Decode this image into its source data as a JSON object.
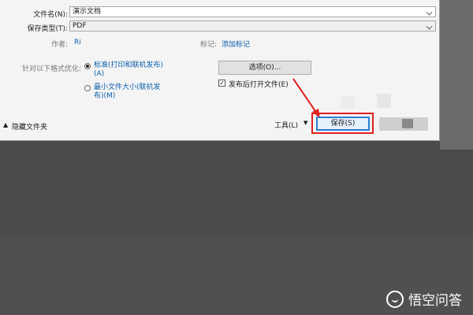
{
  "dialog": {
    "filename_label": "文件名(N):",
    "filename_value": "演示文档",
    "filetype_label": "保存类型(T):",
    "filetype_value": "PDF",
    "author_label": "作者:",
    "author_value": "Ri",
    "tags_label": "标记:",
    "tags_link": "添加标记",
    "optimize_label": "针对以下格式优化:",
    "option_standard_line1": "标准(打印和联机发布)",
    "option_standard_line2": "(A)",
    "option_min_line1": "最小文件大小(联机发",
    "option_min_line2": "布)(M)",
    "options_button": "选项(O)...",
    "open_after_publish": "发布后打开文件(E)",
    "hide_folders": "隐藏文件夹",
    "tools_label": "工具(L)",
    "save_button": "保存(S)"
  },
  "watermark": {
    "text": "悟空问答"
  },
  "colors": {
    "accent_link": "#0b5fae",
    "highlight": "#e02020",
    "save_focus": "#2a7fd4"
  }
}
